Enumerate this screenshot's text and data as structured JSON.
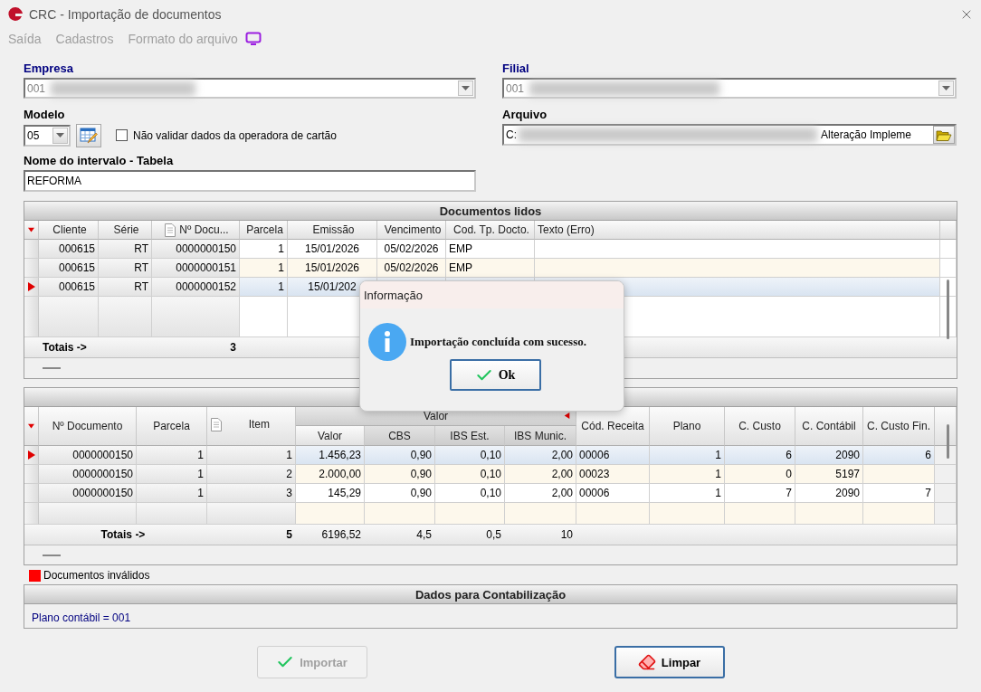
{
  "window": {
    "title": "CRC - Importação de documentos"
  },
  "menu": [
    {
      "label": "Saída",
      "disabled": true
    },
    {
      "label": "Cadastros",
      "disabled": true
    },
    {
      "label": "Formato do arquivo",
      "disabled": true
    }
  ],
  "empresa": {
    "label": "Empresa",
    "value": "001",
    "disabled": true
  },
  "filial": {
    "label": "Filial",
    "value": "001",
    "disabled": true
  },
  "modelo": {
    "label": "Modelo",
    "value": "05"
  },
  "validar": {
    "label": "Não validar dados da operadora de cartão",
    "checked": false
  },
  "nome_intervalo": {
    "label": "Nome do intervalo - Tabela",
    "value": "REFORMA"
  },
  "arquivo": {
    "label": "Arquivo",
    "value_start": "C:",
    "value_end": "Alteração Impleme"
  },
  "documentos_lidos": {
    "title": "Documentos lidos",
    "columns": [
      {
        "label": "Cliente",
        "has_icon": false
      },
      {
        "label": "Série",
        "has_icon": false
      },
      {
        "label": "Nº Docu...",
        "has_icon": true
      },
      {
        "label": "Parcela",
        "has_icon": false
      },
      {
        "label": "Emissão",
        "has_icon": false
      },
      {
        "label": "Vencimento",
        "has_icon": false
      },
      {
        "label": "Cod. Tp. Docto.",
        "has_icon": false
      },
      {
        "label": "Texto (Erro)",
        "has_icon": false
      }
    ],
    "rows": [
      {
        "selected": false,
        "cells": [
          "000615",
          "RT",
          "0000000150",
          "1",
          "15/01/2026",
          "05/02/2026",
          "EMP",
          ""
        ]
      },
      {
        "selected": false,
        "cells": [
          "000615",
          "RT",
          "0000000151",
          "1",
          "15/01/2026",
          "05/02/2026",
          "EMP",
          ""
        ]
      },
      {
        "selected": true,
        "cells": [
          "000615",
          "RT",
          "0000000152",
          "1",
          "15/01/202",
          "",
          "",
          ""
        ]
      }
    ],
    "totals": {
      "label": "Totais ->",
      "count": "3"
    }
  },
  "itens": {
    "group_label": "Valor",
    "columns": [
      {
        "label": "Nº Documento",
        "has_icon": false,
        "in_group": false
      },
      {
        "label": "Parcela",
        "has_icon": false,
        "in_group": false
      },
      {
        "label": "Item",
        "has_icon": true,
        "in_group": false
      },
      {
        "label": "Valor",
        "has_icon": false,
        "in_group": true
      },
      {
        "label": "CBS",
        "has_icon": false,
        "in_group": true
      },
      {
        "label": "IBS Est.",
        "has_icon": false,
        "in_group": true
      },
      {
        "label": "IBS Munic.",
        "has_icon": false,
        "in_group": true
      },
      {
        "label": "Cód. Receita",
        "has_icon": false,
        "in_group": false
      },
      {
        "label": "Plano",
        "has_icon": false,
        "in_group": false
      },
      {
        "label": "C. Custo",
        "has_icon": false,
        "in_group": false
      },
      {
        "label": "C. Contábil",
        "has_icon": false,
        "in_group": false
      },
      {
        "label": "C. Custo Fin.",
        "has_icon": false,
        "in_group": false
      }
    ],
    "rows": [
      {
        "selected": true,
        "cells": [
          "0000000150",
          "1",
          "1",
          "1.456,23",
          "0,90",
          "0,10",
          "2,00",
          "00006",
          "1",
          "6",
          "2090",
          "6"
        ]
      },
      {
        "selected": false,
        "cells": [
          "0000000150",
          "1",
          "2",
          "2.000,00",
          "0,90",
          "0,10",
          "2,00",
          "00023",
          "1",
          "0",
          "5197",
          ""
        ]
      },
      {
        "selected": false,
        "cells": [
          "0000000150",
          "1",
          "3",
          "145,29",
          "0,90",
          "0,10",
          "2,00",
          "00006",
          "1",
          "7",
          "2090",
          "7"
        ]
      }
    ],
    "totals": {
      "label": "Totais ->",
      "values": [
        "5",
        "6196,52",
        "4,5",
        "0,5",
        "10"
      ]
    }
  },
  "legend": {
    "label": "Documentos inválidos",
    "color": "#ff0000"
  },
  "contabilizacao": {
    "title": "Dados para Contabilização",
    "text": "Plano contábil = 001"
  },
  "buttons": [
    {
      "kind": "import",
      "label": "Importar",
      "disabled": true
    },
    {
      "kind": "clear",
      "label": "Limpar",
      "disabled": false
    }
  ],
  "dialog": {
    "title": "Informação",
    "message": "Importação concluída com sucesso.",
    "button": "Ok"
  }
}
